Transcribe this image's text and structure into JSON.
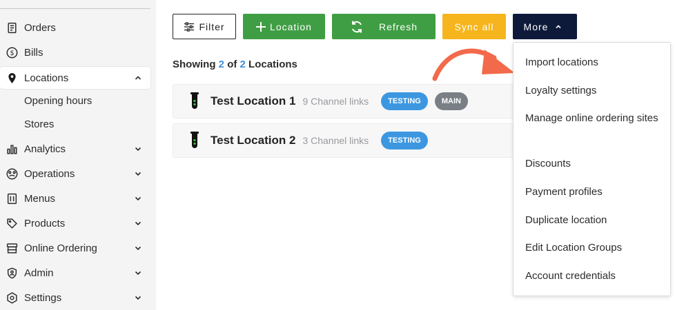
{
  "sidebar": {
    "items": [
      {
        "label": "Orders",
        "icon": "receipt-icon"
      },
      {
        "label": "Bills",
        "icon": "dollar-circle-icon"
      },
      {
        "label": "Locations",
        "icon": "map-pin-icon"
      },
      {
        "label": "Opening hours"
      },
      {
        "label": "Stores"
      },
      {
        "label": "Analytics",
        "icon": "bar-chart-icon"
      },
      {
        "label": "Operations",
        "icon": "dashboard-icon"
      },
      {
        "label": "Menus",
        "icon": "menu-icon"
      },
      {
        "label": "Products",
        "icon": "tag-icon"
      },
      {
        "label": "Online Ordering",
        "icon": "store-icon"
      },
      {
        "label": "Admin",
        "icon": "shield-user-icon"
      },
      {
        "label": "Settings",
        "icon": "gear-icon"
      }
    ]
  },
  "toolbar": {
    "filter_label": "Filter",
    "location_label": "Location",
    "refresh_label": "Refresh",
    "sync_label": "Sync all",
    "more_label": "More"
  },
  "summary": {
    "prefix": "Showing",
    "shown": "2",
    "of": "of",
    "total": "2",
    "suffix": "Locations"
  },
  "locations": [
    {
      "name": "Test Location 1",
      "links": "9 Channel links",
      "badges": [
        "TESTING",
        "MAIN"
      ]
    },
    {
      "name": "Test Location 2",
      "links": "3 Channel links",
      "badges": [
        "TESTING"
      ]
    }
  ],
  "more_menu": {
    "items": [
      "Import locations",
      "Loyalty settings",
      "Manage online ordering sites",
      "Discounts",
      "Payment profiles",
      "Duplicate location",
      "Edit Location Groups",
      "Account credentials"
    ]
  },
  "colors": {
    "green": "#3f9e43",
    "yellow": "#f6b51d",
    "navy": "#0d1a3a",
    "badge_blue": "#3d97e0",
    "badge_gray": "#7a7f86",
    "arrow": "#f26a4b"
  }
}
